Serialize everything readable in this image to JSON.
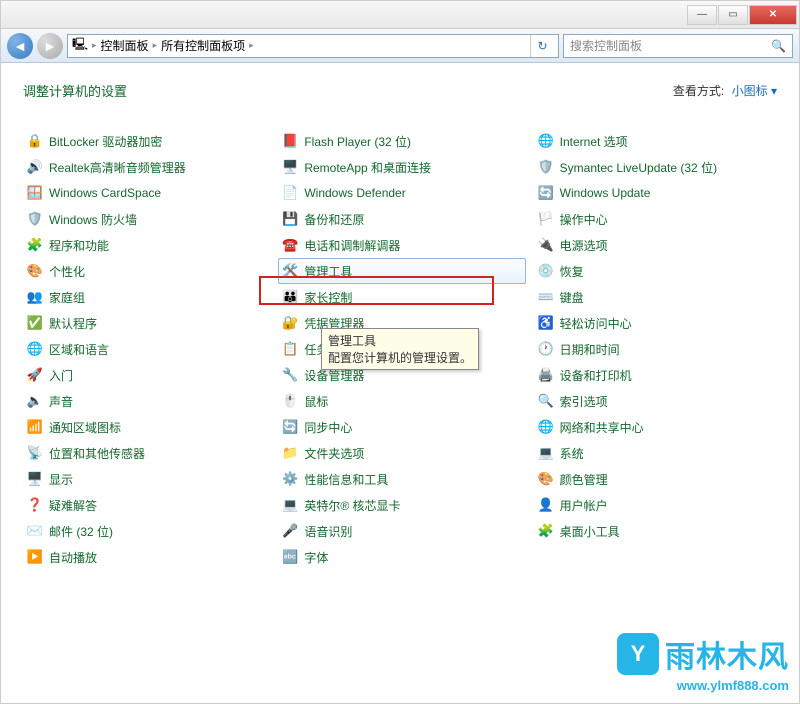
{
  "titlebar": {
    "min": "—",
    "max": "▭",
    "close": "✕"
  },
  "nav": {
    "back": "◄",
    "fwd": "►"
  },
  "breadcrumb": {
    "sep": "▸",
    "root_icon": "🖳",
    "crumb1": "控制面板",
    "crumb2": "所有控制面板项"
  },
  "refresh_icon": "↻",
  "search": {
    "placeholder": "搜索控制面板",
    "icon": "🔍"
  },
  "header_title": "调整计算机的设置",
  "viewby_label": "查看方式:",
  "viewby_value": "小图标",
  "viewby_caret": "▾",
  "tooltip": {
    "title": "管理工具",
    "desc": "配置您计算机的管理设置。"
  },
  "items_col1": [
    {
      "icon": "🔒",
      "label": "BitLocker 驱动器加密"
    },
    {
      "icon": "🔊",
      "label": "Realtek高清晰音频管理器"
    },
    {
      "icon": "🪟",
      "label": "Windows CardSpace"
    },
    {
      "icon": "🛡️",
      "label": "Windows 防火墙"
    },
    {
      "icon": "🧩",
      "label": "程序和功能"
    },
    {
      "icon": "🎨",
      "label": "个性化"
    },
    {
      "icon": "👥",
      "label": "家庭组"
    },
    {
      "icon": "✅",
      "label": "默认程序"
    },
    {
      "icon": "🌐",
      "label": "区域和语言"
    },
    {
      "icon": "🚀",
      "label": "入门"
    },
    {
      "icon": "🔈",
      "label": "声音"
    },
    {
      "icon": "📶",
      "label": "通知区域图标"
    },
    {
      "icon": "📡",
      "label": "位置和其他传感器"
    },
    {
      "icon": "🖥️",
      "label": "显示"
    },
    {
      "icon": "❓",
      "label": "疑难解答"
    },
    {
      "icon": "✉️",
      "label": "邮件 (32 位)"
    },
    {
      "icon": "▶️",
      "label": "自动播放"
    }
  ],
  "items_col2": [
    {
      "icon": "📕",
      "label": "Flash Player (32 位)"
    },
    {
      "icon": "🖥️",
      "label": "RemoteApp 和桌面连接"
    },
    {
      "icon": "📄",
      "label": "Windows Defender"
    },
    {
      "icon": "💾",
      "label": "备份和还原"
    },
    {
      "icon": "☎️",
      "label": "电话和调制解调器"
    },
    {
      "icon": "🛠️",
      "label": "管理工具",
      "hovered": true
    },
    {
      "icon": "👪",
      "label": "家长控制"
    },
    {
      "icon": "🔐",
      "label": "凭据管理器"
    },
    {
      "icon": "📋",
      "label": "任务栏和「开始」菜单"
    },
    {
      "icon": "🔧",
      "label": "设备管理器"
    },
    {
      "icon": "🖱️",
      "label": "鼠标"
    },
    {
      "icon": "🔄",
      "label": "同步中心"
    },
    {
      "icon": "📁",
      "label": "文件夹选项"
    },
    {
      "icon": "⚙️",
      "label": "性能信息和工具"
    },
    {
      "icon": "💻",
      "label": "英特尔® 核芯显卡"
    },
    {
      "icon": "🎤",
      "label": "语音识别"
    },
    {
      "icon": "🔤",
      "label": "字体"
    }
  ],
  "items_col3": [
    {
      "icon": "🌐",
      "label": "Internet 选项"
    },
    {
      "icon": "🛡️",
      "label": "Symantec LiveUpdate (32 位)"
    },
    {
      "icon": "🔄",
      "label": "Windows Update"
    },
    {
      "icon": "🏳️",
      "label": "操作中心"
    },
    {
      "icon": "🔌",
      "label": "电源选项"
    },
    {
      "icon": "💿",
      "label": "恢复"
    },
    {
      "icon": "⌨️",
      "label": "键盘"
    },
    {
      "icon": "♿",
      "label": "轻松访问中心"
    },
    {
      "icon": "🕐",
      "label": "日期和时间"
    },
    {
      "icon": "🖨️",
      "label": "设备和打印机"
    },
    {
      "icon": "🔍",
      "label": "索引选项"
    },
    {
      "icon": "🌐",
      "label": "网络和共享中心"
    },
    {
      "icon": "💻",
      "label": "系统"
    },
    {
      "icon": "🎨",
      "label": "颜色管理"
    },
    {
      "icon": "👤",
      "label": "用户帐户"
    },
    {
      "icon": "🧩",
      "label": "桌面小工具"
    }
  ],
  "watermark": {
    "logo_char": "Y",
    "brand": "雨林木风",
    "url": "www.ylmf888.com"
  }
}
